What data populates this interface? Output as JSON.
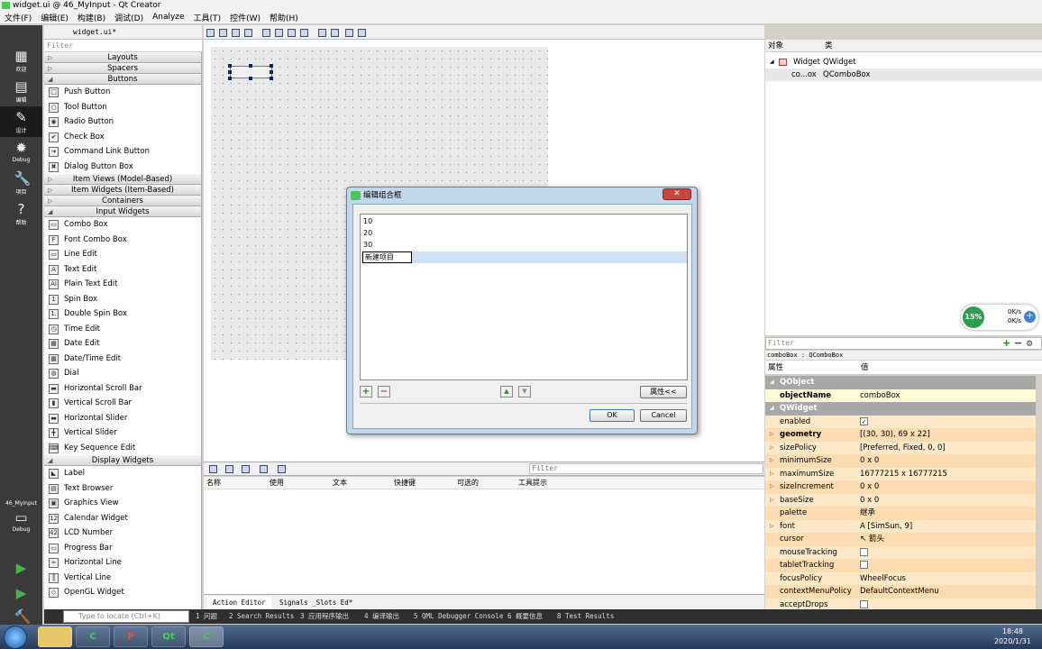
{
  "window": {
    "title": "widget.ui @ 46_MyInput - Qt Creator"
  },
  "menu": [
    "文件(F)",
    "编辑(E)",
    "构建(B)",
    "调试(D)",
    "Analyze",
    "工具(T)",
    "控件(W)",
    "帮助(H)"
  ],
  "modes": [
    {
      "label": "欢迎",
      "icon": "▦"
    },
    {
      "label": "编辑",
      "icon": "▤"
    },
    {
      "label": "设计",
      "icon": "✎"
    },
    {
      "label": "Debug",
      "icon": "✹"
    },
    {
      "label": "项目",
      "icon": "🔧"
    },
    {
      "label": "帮助",
      "icon": "?"
    }
  ],
  "kit": {
    "project": "46_MyInput",
    "label": "Debug"
  },
  "editor": {
    "file": "widget.ui*"
  },
  "widgetbox": {
    "filter": "Filter",
    "sections": [
      {
        "type": "cat",
        "label": "Layouts",
        "open": false
      },
      {
        "type": "cat",
        "label": "Spacers",
        "open": false
      },
      {
        "type": "cat",
        "label": "Buttons",
        "open": true
      },
      {
        "type": "item",
        "label": "Push Button",
        "icon": "□"
      },
      {
        "type": "item",
        "label": "Tool Button",
        "icon": "○"
      },
      {
        "type": "item",
        "label": "Radio Button",
        "icon": "◉"
      },
      {
        "type": "item",
        "label": "Check Box",
        "icon": "✔"
      },
      {
        "type": "item",
        "label": "Command Link Button",
        "icon": "➔"
      },
      {
        "type": "item",
        "label": "Dialog Button Box",
        "icon": "✖"
      },
      {
        "type": "cat",
        "label": "Item Views (Model-Based)",
        "open": false
      },
      {
        "type": "cat",
        "label": "Item Widgets (Item-Based)",
        "open": false
      },
      {
        "type": "cat",
        "label": "Containers",
        "open": false
      },
      {
        "type": "cat",
        "label": "Input Widgets",
        "open": true
      },
      {
        "type": "item",
        "label": "Combo Box",
        "icon": "▭"
      },
      {
        "type": "item",
        "label": "Font Combo Box",
        "icon": "F"
      },
      {
        "type": "item",
        "label": "Line Edit",
        "icon": "▭"
      },
      {
        "type": "item",
        "label": "Text Edit",
        "icon": "A"
      },
      {
        "type": "item",
        "label": "Plain Text Edit",
        "icon": "AI"
      },
      {
        "type": "item",
        "label": "Spin Box",
        "icon": "1"
      },
      {
        "type": "item",
        "label": "Double Spin Box",
        "icon": "1."
      },
      {
        "type": "item",
        "label": "Time Edit",
        "icon": "◷"
      },
      {
        "type": "item",
        "label": "Date Edit",
        "icon": "▦"
      },
      {
        "type": "item",
        "label": "Date/Time Edit",
        "icon": "▦"
      },
      {
        "type": "item",
        "label": "Dial",
        "icon": "◍"
      },
      {
        "type": "item",
        "label": "Horizontal Scroll Bar",
        "icon": "▬"
      },
      {
        "type": "item",
        "label": "Vertical Scroll Bar",
        "icon": "▮"
      },
      {
        "type": "item",
        "label": "Horizontal Slider",
        "icon": "▬"
      },
      {
        "type": "item",
        "label": "Vertical Slider",
        "icon": "╋"
      },
      {
        "type": "item",
        "label": "Key Sequence Edit",
        "icon": "⌨"
      },
      {
        "type": "cat",
        "label": "Display Widgets",
        "open": true
      },
      {
        "type": "item",
        "label": "Label",
        "icon": "◣"
      },
      {
        "type": "item",
        "label": "Text Browser",
        "icon": "▤"
      },
      {
        "type": "item",
        "label": "Graphics View",
        "icon": "▣"
      },
      {
        "type": "item",
        "label": "Calendar Widget",
        "icon": "12"
      },
      {
        "type": "item",
        "label": "LCD Number",
        "icon": "42"
      },
      {
        "type": "item",
        "label": "Progress Bar",
        "icon": "▭"
      },
      {
        "type": "item",
        "label": "Horizontal Line",
        "icon": "═"
      },
      {
        "type": "item",
        "label": "Vertical Line",
        "icon": "║"
      },
      {
        "type": "item",
        "label": "OpenGL Widget",
        "icon": "◇"
      }
    ]
  },
  "actioneditor": {
    "filter": "Filter",
    "columns": [
      "名称",
      "使用",
      "文本",
      "快捷键",
      "可选的",
      "工具提示"
    ],
    "tabs": [
      "Action Editor",
      "Signals _Slots Ed*"
    ]
  },
  "outputbar": {
    "locate": "Type to locate (Ctrl+K)",
    "items": [
      "1 问题",
      "2 Search Results",
      "3 应用程序输出",
      "4 编译输出",
      "5 QML Debugger Console",
      "6 概要信息",
      "8 Test Results"
    ]
  },
  "objectinspector": {
    "headers": [
      "对象",
      "类"
    ],
    "rows": [
      {
        "name": "Widget",
        "class": "QWidget"
      },
      {
        "name": "co...ox",
        "class": "QComboBox"
      }
    ]
  },
  "propertyeditor": {
    "filter": "Filter",
    "classline": "comboBox : QComboBox",
    "headers": [
      "属性",
      "值"
    ],
    "rows": [
      {
        "g": true,
        "n": "QObject"
      },
      {
        "n": "objectName",
        "v": "comboBox",
        "c": "y1",
        "b": true
      },
      {
        "g": true,
        "n": "QWidget"
      },
      {
        "n": "enabled",
        "v": "✓",
        "c": "o1",
        "cb": true
      },
      {
        "n": "geometry",
        "v": "[(30, 30), 69 x 22]",
        "c": "o2",
        "a": true,
        "b": true
      },
      {
        "n": "sizePolicy",
        "v": "[Preferred, Fixed, 0, 0]",
        "c": "o1",
        "a": true
      },
      {
        "n": "minimumSize",
        "v": "0 x 0",
        "c": "o2",
        "a": true
      },
      {
        "n": "maximumSize",
        "v": "16777215 x 16777215",
        "c": "o1",
        "a": true
      },
      {
        "n": "sizeIncrement",
        "v": "0 x 0",
        "c": "o2",
        "a": true
      },
      {
        "n": "baseSize",
        "v": "0 x 0",
        "c": "o1",
        "a": true
      },
      {
        "n": "palette",
        "v": "继承",
        "c": "o2"
      },
      {
        "n": "font",
        "v": "A  [SimSun, 9]",
        "c": "o1",
        "a": true
      },
      {
        "n": "cursor",
        "v": "↖  箭头",
        "c": "o2"
      },
      {
        "n": "mouseTracking",
        "v": "",
        "c": "o1",
        "cb": true
      },
      {
        "n": "tabletTracking",
        "v": "",
        "c": "o2",
        "cb": true
      },
      {
        "n": "focusPolicy",
        "v": "WheelFocus",
        "c": "o1"
      },
      {
        "n": "contextMenuPolicy",
        "v": "DefaultContextMenu",
        "c": "o2"
      },
      {
        "n": "acceptDrops",
        "v": "",
        "c": "o1",
        "cb": true
      }
    ]
  },
  "dialog": {
    "title": "编辑组合框",
    "items": [
      "10",
      "20",
      "30"
    ],
    "newitem": "新建项目",
    "add": "+",
    "remove": "−",
    "up": "▲",
    "down": "▼",
    "props": "属性<<",
    "ok": "OK",
    "cancel": "Cancel"
  },
  "netwidget": {
    "percent": "15%",
    "up": "0K/s",
    "down": "0K/s"
  },
  "taskbar": {
    "apps": [
      "",
      "",
      "",
      "",
      "",
      ""
    ],
    "time": "18:48",
    "date": "2020/1/31"
  }
}
